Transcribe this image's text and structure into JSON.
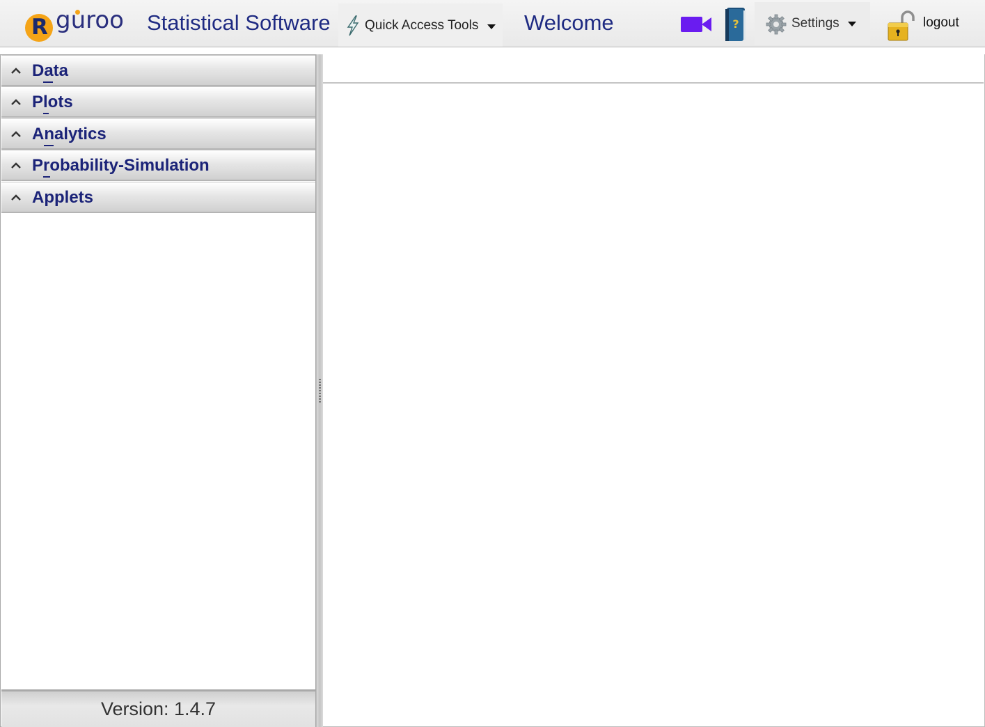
{
  "header": {
    "logo_text": "guroo",
    "logo_letter": "R",
    "app_title": "Statistical Software",
    "quick_access_label": "Quick Access Tools",
    "welcome": "Welcome",
    "settings_label": "Settings",
    "logout_label": "logout",
    "icons": [
      "lightning-icon",
      "video-camera-icon",
      "help-book-icon",
      "gear-icon",
      "unlocked-padlock-icon"
    ]
  },
  "sidebar": {
    "items": [
      {
        "label": "Data",
        "mnemonic": "a"
      },
      {
        "label": "Plots",
        "mnemonic": "l"
      },
      {
        "label": "Analytics",
        "mnemonic": "n"
      },
      {
        "label": "Probability-Simulation",
        "mnemonic": "r"
      },
      {
        "label": "Applets",
        "mnemonic": ""
      }
    ],
    "version": "Version: 1.4.7"
  },
  "colors": {
    "title_blue": "#1e2a82",
    "accordion_label": "#1b2378",
    "logo_orange": "#f5a417",
    "video_purple": "#6a1cf0"
  }
}
